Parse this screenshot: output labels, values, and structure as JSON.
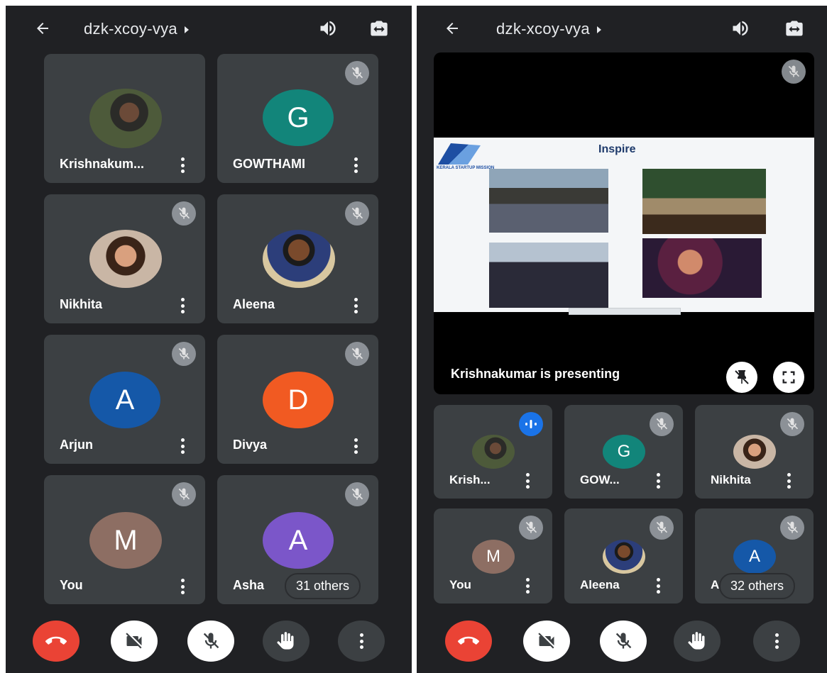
{
  "left_screen": {
    "meeting_code": "dzk-xcoy-vya",
    "tiles": [
      {
        "name": "Krishnakum...",
        "avatar": "photo",
        "muted": false
      },
      {
        "name": "GOWTHAMI",
        "avatar_letter": "G",
        "avatar_color": "#12857a",
        "muted": true
      },
      {
        "name": "Nikhita",
        "avatar": "photo",
        "muted": true
      },
      {
        "name": "Aleena",
        "avatar": "photo",
        "muted": true
      },
      {
        "name": "Arjun",
        "avatar_letter": "A",
        "avatar_color": "#1558a8",
        "muted": true
      },
      {
        "name": "Divya",
        "avatar_letter": "D",
        "avatar_color": "#f15a22",
        "muted": true
      },
      {
        "name": "You",
        "avatar_letter": "M",
        "avatar_color": "#8d6e63",
        "muted": true
      },
      {
        "name": "Asha",
        "avatar_letter": "A",
        "avatar_color": "#7b56c9",
        "muted": true
      }
    ],
    "others_label": "31 others"
  },
  "right_screen": {
    "meeting_code": "dzk-xcoy-vya",
    "presentation": {
      "caption": "Krishnakumar is presenting",
      "slide_title": "Inspire",
      "slide_logo_text": "KERALA STARTUP MISSION"
    },
    "tiles": [
      {
        "name": "Krish...",
        "avatar": "photo",
        "speaking": true
      },
      {
        "name": "GOW...",
        "avatar_letter": "G",
        "avatar_color": "#12857a",
        "muted": true
      },
      {
        "name": "Nikhita",
        "avatar": "photo",
        "muted": true
      },
      {
        "name": "You",
        "avatar_letter": "M",
        "avatar_color": "#8d6e63",
        "muted": true
      },
      {
        "name": "Aleena",
        "avatar": "photo",
        "muted": true
      },
      {
        "name": "Ar",
        "avatar_letter": "A",
        "avatar_color": "#1558a8",
        "muted": true
      }
    ],
    "others_label": "32 others"
  },
  "controls": [
    "end-call",
    "camera-off",
    "mic-off",
    "raise-hand",
    "more-options"
  ],
  "colors": {
    "background": "#202124",
    "tile": "#3c4043",
    "end_call": "#ea4335",
    "accent_blue": "#1a73e8"
  }
}
